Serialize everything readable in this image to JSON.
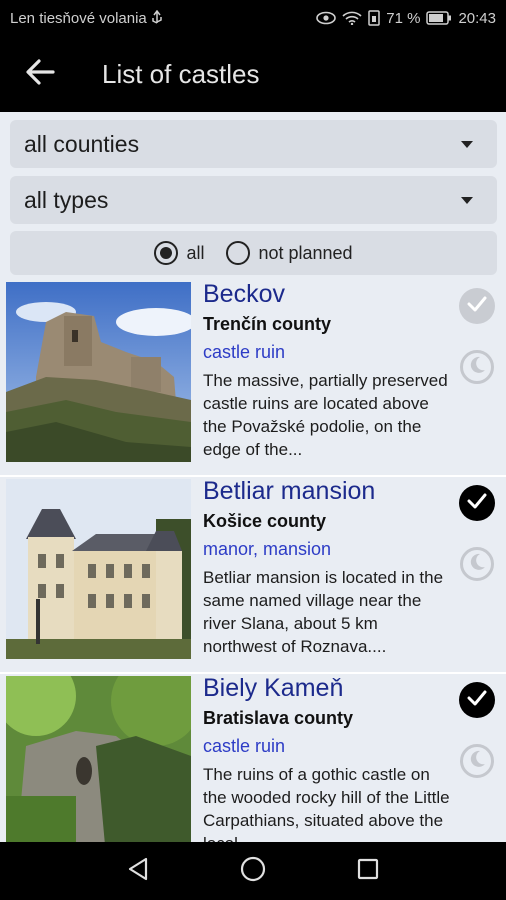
{
  "status_bar": {
    "carrier": "Len tiesňové volania",
    "battery": "71 %",
    "time": "20:43"
  },
  "app_bar": {
    "title": "List of castles"
  },
  "filters": {
    "county_select": "all counties",
    "type_select": "all types",
    "radio": {
      "option_all": "all",
      "option_not_planned": "not planned",
      "selected": "all"
    }
  },
  "castles": [
    {
      "name": "Beckov",
      "county": "Trenčín county",
      "type": "castle ruin",
      "description": "The massive, partially preserved castle ruins are located above the Považské podolie, on the edge of the...",
      "visited": false
    },
    {
      "name": "Betliar mansion",
      "county": "Košice county",
      "type": "manor, mansion",
      "description": "Betliar mansion is located in the same named village near the river Slana, about 5 km northwest of Roznava....",
      "visited": true
    },
    {
      "name": "Biely Kameň",
      "county": "Bratislava county",
      "type": "castle ruin",
      "description": "The ruins of a gothic castle on the wooded rocky hill of the Little Carpathians, situated above the local...",
      "visited": true
    }
  ],
  "colors": {
    "name": "#1c2a8c",
    "type": "#2d3cc6",
    "background": "#e9edf3",
    "control": "#d9dde4"
  }
}
